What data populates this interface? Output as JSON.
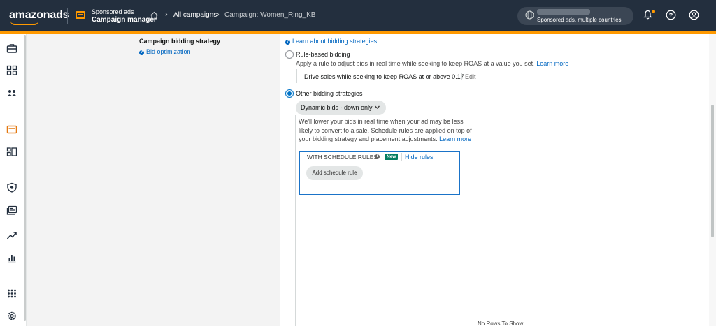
{
  "header": {
    "logo": "amazonads",
    "app_line1": "Sponsored ads",
    "app_line2": "Campaign manager",
    "breadcrumbs": [
      "All campaigns",
      "Campaign: Women_Ring_KB"
    ],
    "account_text": "Sponsored ads, multiple countries",
    "notification_dot_color": "#ff9900"
  },
  "left_nav": {
    "icons": [
      "briefcase-icon",
      "dashboard-icon",
      "people-icon",
      "campaign-icon",
      "ad-groups-icon",
      "shield-icon",
      "media-icon",
      "trend-icon",
      "bar-chart-icon",
      "apps-grid-icon",
      "settings-icon"
    ]
  },
  "section": {
    "title": "Campaign bidding strategy",
    "bid_link": "Bid optimization",
    "learn_link": "Learn about bidding strategies"
  },
  "options": {
    "rule_based": {
      "label": "Rule-based bidding",
      "desc": "Apply a rule to adjust bids in real time while seeking to keep ROAS at a value you set.",
      "learn_more": "Learn more",
      "rule_text": "Drive sales while seeking to keep ROAS at or above 0.17",
      "edit": "Edit",
      "selected": false
    },
    "other": {
      "label": "Other bidding strategies",
      "selected": true,
      "dropdown_value": "Dynamic bids - down only",
      "desc": "We'll lower your bids in real time when your ad may be less likely to convert to a sale. Schedule rules are applied on top of your bidding strategy and placement adjustments.",
      "learn_more": "Learn more"
    }
  },
  "schedule": {
    "label": "WITH SCHEDULE RULES",
    "badge": "New",
    "hide_link": "Hide rules",
    "add_button": "Add schedule rule"
  },
  "table": {
    "empty_text": "No Rows To Show"
  }
}
